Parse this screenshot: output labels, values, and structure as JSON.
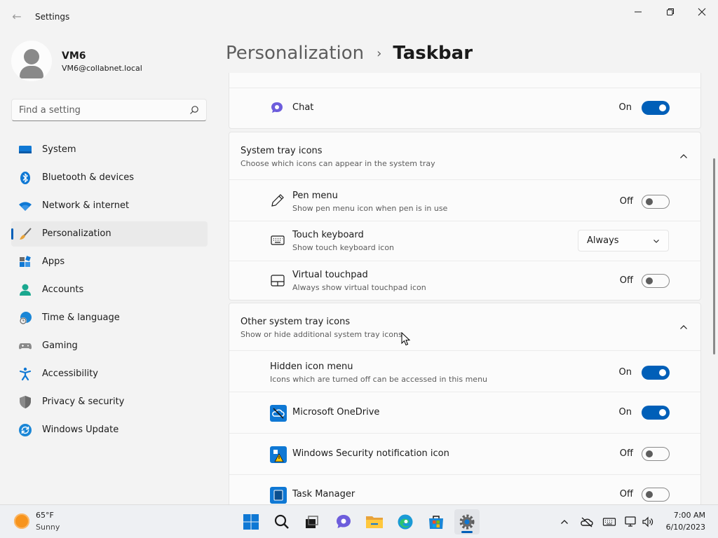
{
  "window": {
    "title": "Settings",
    "back_label": "←"
  },
  "user": {
    "name": "VM6",
    "email": "VM6@collabnet.local"
  },
  "search": {
    "placeholder": "Find a setting"
  },
  "sidebar": {
    "items": [
      {
        "label": "System",
        "icon": "monitor-icon"
      },
      {
        "label": "Bluetooth & devices",
        "icon": "bluetooth-icon"
      },
      {
        "label": "Network & internet",
        "icon": "wifi-icon"
      },
      {
        "label": "Personalization",
        "icon": "paintbrush-icon",
        "active": true
      },
      {
        "label": "Apps",
        "icon": "apps-icon"
      },
      {
        "label": "Accounts",
        "icon": "person-icon"
      },
      {
        "label": "Time & language",
        "icon": "globe-clock-icon"
      },
      {
        "label": "Gaming",
        "icon": "gamepad-icon"
      },
      {
        "label": "Accessibility",
        "icon": "accessibility-icon"
      },
      {
        "label": "Privacy & security",
        "icon": "shield-icon"
      },
      {
        "label": "Windows Update",
        "icon": "update-icon"
      }
    ]
  },
  "breadcrumb": {
    "parent": "Personalization",
    "separator": "›",
    "current": "Taskbar"
  },
  "chat": {
    "title": "Chat",
    "state": "On"
  },
  "system_tray": {
    "title": "System tray icons",
    "description": "Choose which icons can appear in the system tray",
    "items": [
      {
        "title": "Pen menu",
        "description": "Show pen menu icon when pen is in use",
        "state": "Off"
      },
      {
        "title": "Touch keyboard",
        "description": "Show touch keyboard icon",
        "value": "Always"
      },
      {
        "title": "Virtual touchpad",
        "description": "Always show virtual touchpad icon",
        "state": "Off"
      }
    ]
  },
  "other_tray": {
    "title": "Other system tray icons",
    "description": "Show or hide additional system tray icons",
    "hidden_menu": {
      "title": "Hidden icon menu",
      "description": "Icons which are turned off can be accessed in this menu",
      "state": "On"
    },
    "items": [
      {
        "title": "Microsoft OneDrive",
        "state": "On"
      },
      {
        "title": "Windows Security notification icon",
        "state": "Off"
      },
      {
        "title": "Task Manager",
        "state": "Off"
      }
    ]
  },
  "taskbar": {
    "weather_temp": "65°F",
    "weather_desc": "Sunny",
    "time": "7:00 AM",
    "date": "6/10/2023"
  },
  "colors": {
    "accent": "#005fb8",
    "background": "#f3f3f3",
    "card": "#fbfbfb"
  }
}
